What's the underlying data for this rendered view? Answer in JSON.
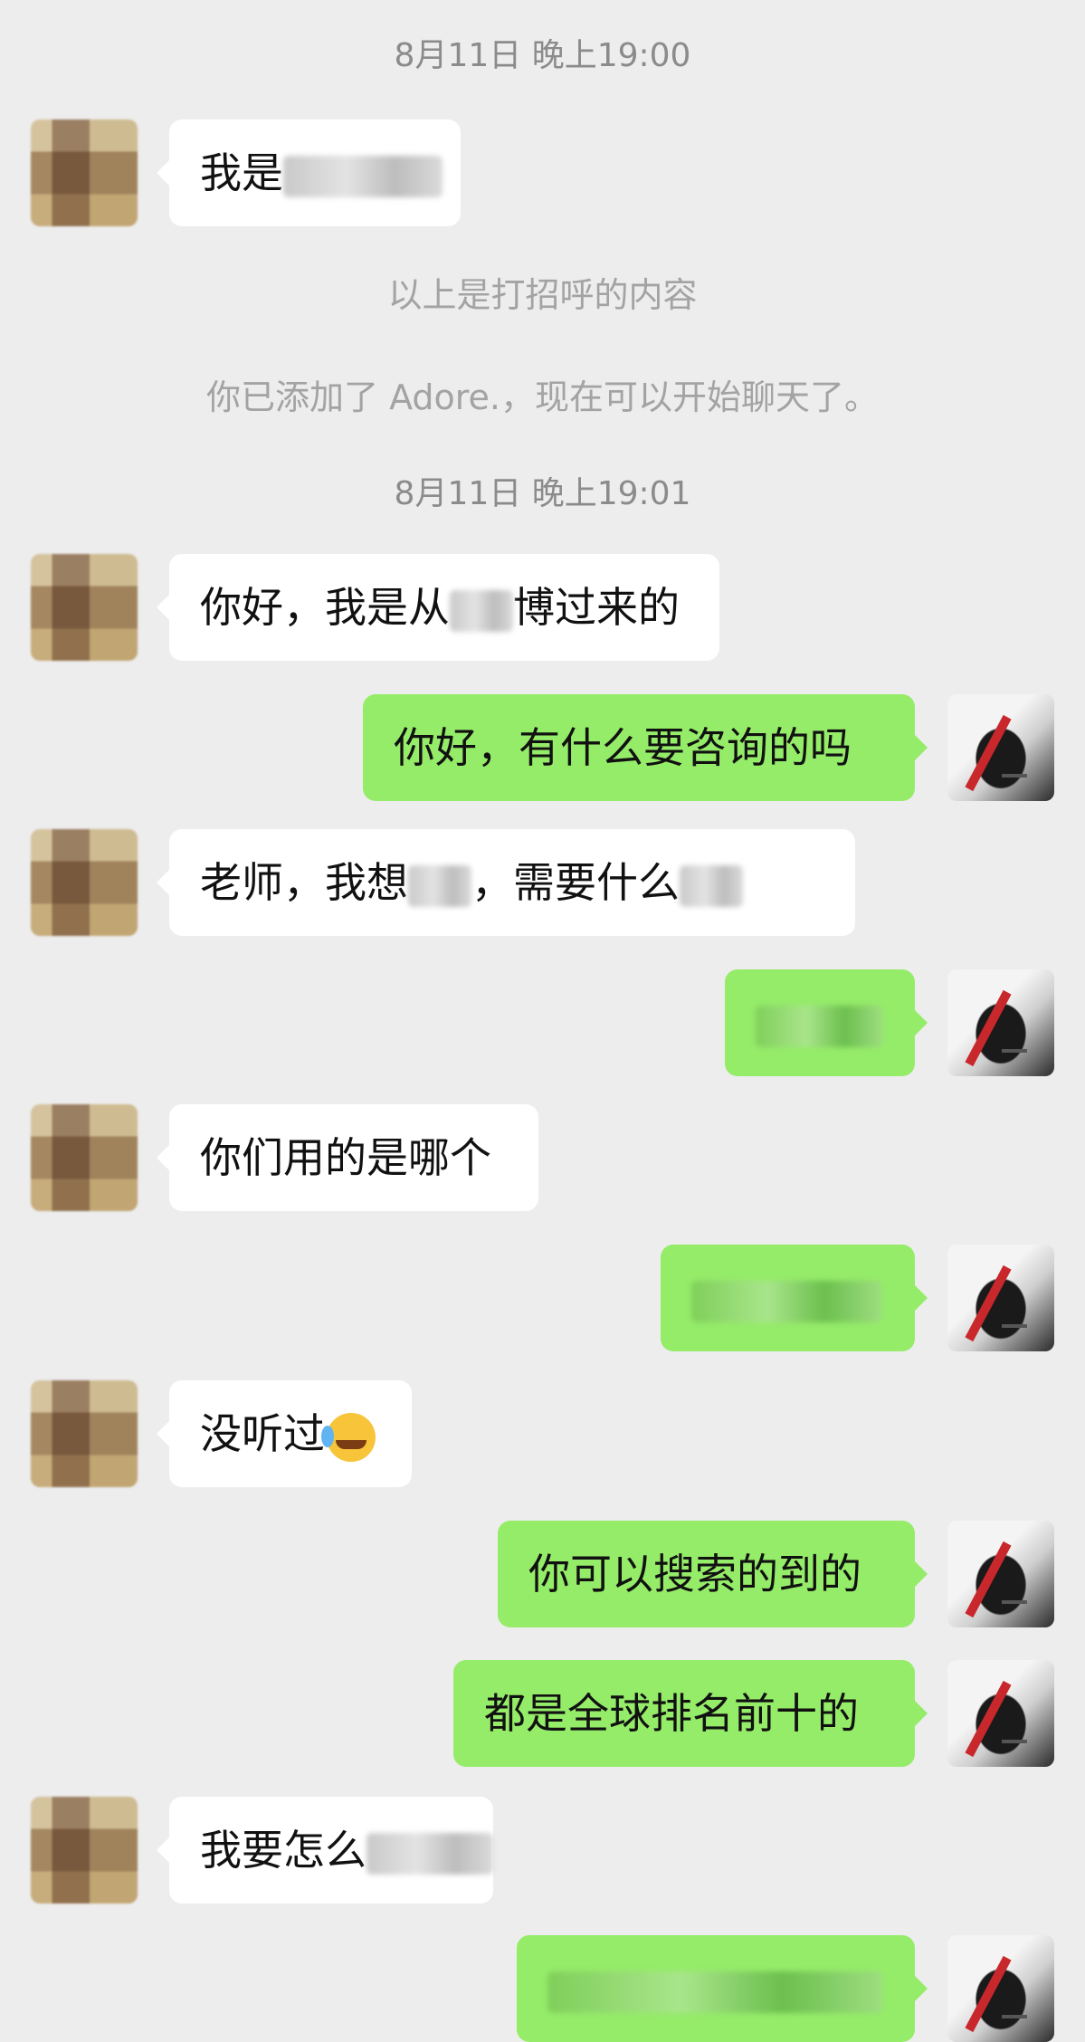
{
  "timestamps": [
    "8月11日 晚上19:00",
    "8月11日 晚上19:01"
  ],
  "system_messages": [
    "以上是打招呼的内容",
    "你已添加了 Adore.，现在可以开始聊天了。"
  ],
  "messages": [
    {
      "side": "in",
      "text": "我是"
    },
    {
      "side": "in",
      "text_a": "你好，我是从",
      "text_b": "博过来的"
    },
    {
      "side": "out",
      "text": "你好，有什么要咨询的吗"
    },
    {
      "side": "in",
      "text_a": "老师，我想",
      "text_b": "，需要什么"
    },
    {
      "side": "out",
      "text": ""
    },
    {
      "side": "in",
      "text": "你们用的是哪个"
    },
    {
      "side": "out",
      "text": ""
    },
    {
      "side": "in",
      "text": "没听过",
      "emoji": "face-with-tears-of-joy-icon"
    },
    {
      "side": "out",
      "text": "你可以搜索的到的"
    },
    {
      "side": "out",
      "text": "都是全球排名前十的"
    },
    {
      "side": "in",
      "text": "我要怎么"
    },
    {
      "side": "out",
      "text": ""
    }
  ],
  "colors": {
    "background": "#ededed",
    "incoming_bubble": "#ffffff",
    "outgoing_bubble": "#95ec69",
    "timestamp_text": "#8b8b8b",
    "system_text": "#a3a3a3"
  }
}
